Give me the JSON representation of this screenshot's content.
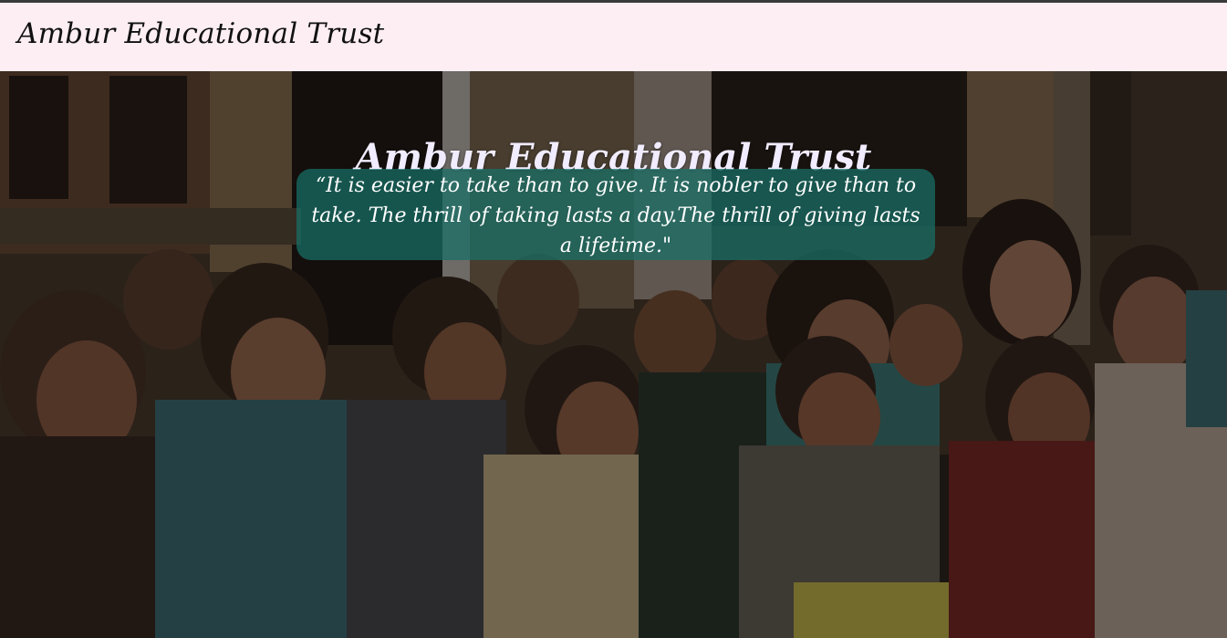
{
  "navbar": {
    "brand": "Ambur Educational Trust",
    "background_color": "#fdeef3"
  },
  "hero": {
    "title": "Ambur Educational Trust",
    "quote": "“It is easier to take than to give. It is nobler to give than to take. The thrill of taking lasts a day.The thrill of giving lasts a lifetime.\"",
    "quote_box_color": "#177068",
    "image_description_icon": "children-photo"
  }
}
